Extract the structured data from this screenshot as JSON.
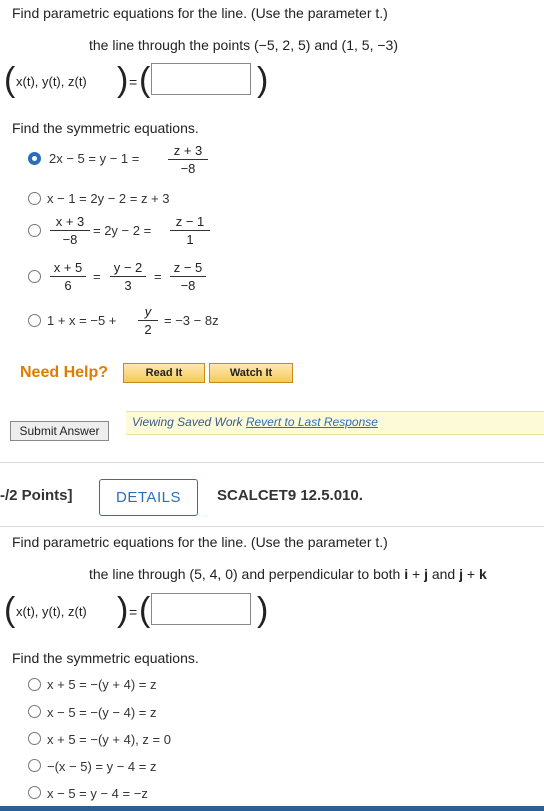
{
  "q1": {
    "prompt": "Find parametric equations for the line. (Use the parameter t.)",
    "line_desc": "the line through the points (−5, 2, 5) and (1, 5, −3)",
    "vector_label": "x(t), y(t), z(t)",
    "equals": "=",
    "answer_value": "",
    "symmetric_prompt": "Find the symmetric equations.",
    "options": [
      {
        "selected": true
      },
      {
        "selected": false,
        "text": "x − 1 = 2y − 2 = z + 3"
      },
      {
        "selected": false
      },
      {
        "selected": false
      },
      {
        "selected": false
      }
    ],
    "opt1": {
      "lhs": "2x − 5 = y − 1 =",
      "num": "z + 3",
      "den": "−8"
    },
    "opt3": {
      "n1": "x + 3",
      "d1": "−8",
      "mid": "= 2y − 2 =",
      "n2": "z − 1",
      "d2": "1"
    },
    "opt4": {
      "n1": "x + 5",
      "d1": "6",
      "n2": "y − 2",
      "d2": "3",
      "n3": "z − 5",
      "d3": "−8",
      "eq": "="
    },
    "opt5": {
      "lhs": "1 + x = −5 +",
      "num": "y",
      "den": "2",
      "rhs": "= −3 − 8z"
    },
    "help": {
      "label": "Need Help?",
      "read_it": "Read It",
      "watch_it": "Watch It"
    },
    "submit_label": "Submit Answer",
    "saved": {
      "text": "Viewing Saved Work ",
      "revert": "Revert to Last Response"
    }
  },
  "q2": {
    "points": "-/2 Points]",
    "details": "DETAILS",
    "code": "SCALCET9 12.5.010.",
    "prompt": "Find parametric equations for the line. (Use the parameter t.)",
    "line_desc_pre": "the line through (5, 4, 0) and perpendicular to both ",
    "i": "i",
    "plus1": " + ",
    "j1": "j",
    "and": " and ",
    "j2": "j",
    "plus2": " + ",
    "k": "k",
    "vector_label": "x(t), y(t), z(t)",
    "equals": "=",
    "answer_value": "",
    "symmetric_prompt": "Find the symmetric equations.",
    "options": [
      {
        "selected": false,
        "text": "x + 5 = −(y + 4) = z"
      },
      {
        "selected": false,
        "text": "x − 5 = −(y − 4) = z"
      },
      {
        "selected": false,
        "text": "x + 5 = −(y + 4), z = 0"
      },
      {
        "selected": false,
        "text": "−(x − 5) = y − 4 = z"
      },
      {
        "selected": false,
        "text": "x − 5 = y − 4 = −z"
      }
    ]
  },
  "colors": {
    "accent": "#2a6ebb",
    "help_orange": "#e07b00",
    "saved_bg": "#fdfbd7"
  }
}
